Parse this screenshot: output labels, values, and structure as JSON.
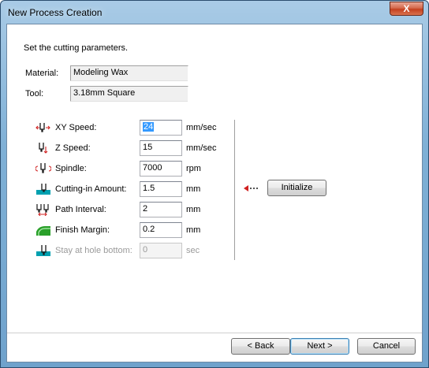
{
  "window": {
    "title": "New Process Creation",
    "close_label": "X"
  },
  "instructions": "Set the cutting parameters.",
  "material": {
    "label": "Material:",
    "value": "Modeling Wax"
  },
  "tool": {
    "label": "Tool:",
    "value": "3.18mm Square"
  },
  "params": [
    {
      "label": "XY Speed:",
      "value": "24",
      "unit": "mm/sec",
      "icon": "xy-speed-icon"
    },
    {
      "label": "Z Speed:",
      "value": "15",
      "unit": "mm/sec",
      "icon": "z-speed-icon"
    },
    {
      "label": "Spindle:",
      "value": "7000",
      "unit": "rpm",
      "icon": "spindle-icon"
    },
    {
      "label": "Cutting-in Amount:",
      "value": "1.5",
      "unit": "mm",
      "icon": "cutting-in-icon"
    },
    {
      "label": "Path Interval:",
      "value": "2",
      "unit": "mm",
      "icon": "path-interval-icon"
    },
    {
      "label": "Finish Margin:",
      "value": "0.2",
      "unit": "mm",
      "icon": "finish-margin-icon"
    },
    {
      "label": "Stay at hole bottom:",
      "value": "0",
      "unit": "sec",
      "icon": "stay-hole-icon"
    }
  ],
  "initialize": {
    "label": "Initialize",
    "icon": "arrow-left-icon"
  },
  "footer": {
    "back": "< Back",
    "next": "Next >",
    "cancel": "Cancel"
  },
  "colors": {
    "accent": "#3399ff",
    "icon_teal": "#00a0b0",
    "icon_red": "#d02020",
    "icon_green": "#2aa02a"
  }
}
